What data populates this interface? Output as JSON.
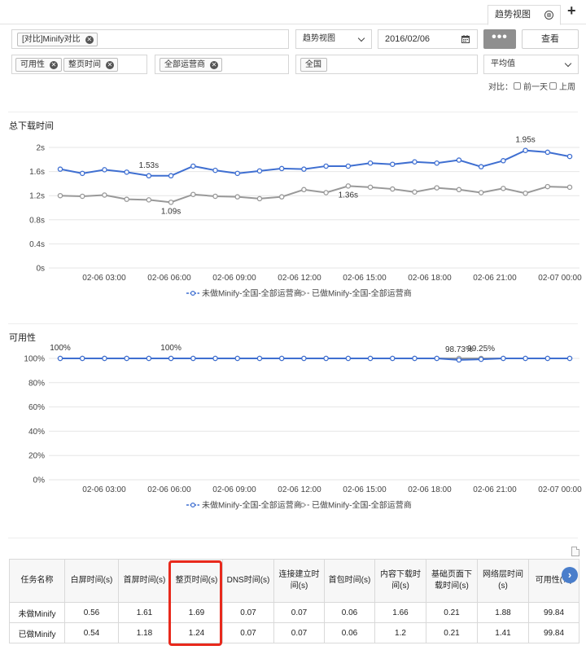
{
  "tabs": {
    "active_label": "趋势视图",
    "close_glyph": "⊗",
    "add_glyph": "+"
  },
  "filters": {
    "task_chip": "[对比]Minify对比",
    "view_select": "趋势视图",
    "date_value": "2016/02/06",
    "more_label": "•••",
    "query_label": "查看",
    "metric_chips": [
      "可用性",
      "整页时间"
    ],
    "isp_chip": "全部运营商",
    "region_chip": "全国",
    "aggregate_select": "平均值",
    "compare_label": "对比：",
    "compare_options": [
      "前一天",
      "上周"
    ]
  },
  "chart_data": [
    {
      "type": "line",
      "title": "总下载时间",
      "x_ticks": [
        "02-06 03:00",
        "02-06 06:00",
        "02-06 09:00",
        "02-06 12:00",
        "02-06 15:00",
        "02-06 18:00",
        "02-06 21:00",
        "02-07 00:00"
      ],
      "y_ticks": [
        "2s",
        "1.6s",
        "1.2s",
        "0.8s",
        "0.4s",
        "0s"
      ],
      "ylim": [
        0,
        2
      ],
      "x_index_range": [
        0,
        23
      ],
      "series": [
        {
          "name": "未做Minify-全国-全部运营商",
          "color": "#3f6fd1",
          "values": [
            1.64,
            1.57,
            1.63,
            1.59,
            1.53,
            1.53,
            1.69,
            1.62,
            1.57,
            1.61,
            1.65,
            1.64,
            1.69,
            1.69,
            1.74,
            1.72,
            1.76,
            1.74,
            1.79,
            1.68,
            1.78,
            1.95,
            1.92,
            1.85
          ]
        },
        {
          "name": "已做Minify-全国-全部运营商",
          "color": "#999999",
          "values": [
            1.2,
            1.19,
            1.21,
            1.14,
            1.13,
            1.09,
            1.22,
            1.19,
            1.18,
            1.15,
            1.18,
            1.3,
            1.25,
            1.36,
            1.34,
            1.31,
            1.26,
            1.33,
            1.3,
            1.25,
            1.32,
            1.24,
            1.35,
            1.34
          ]
        }
      ],
      "annotations": [
        {
          "series": 0,
          "index": 4,
          "label": "1.53s"
        },
        {
          "series": 1,
          "index": 5,
          "label": "1.09s"
        },
        {
          "series": 1,
          "index": 13,
          "label": "1.36s"
        },
        {
          "series": 0,
          "index": 21,
          "label": "1.95s"
        }
      ],
      "legend_position": "bottom-center",
      "grid": true
    },
    {
      "type": "line",
      "title": "可用性",
      "x_ticks": [
        "02-06 03:00",
        "02-06 06:00",
        "02-06 09:00",
        "02-06 12:00",
        "02-06 15:00",
        "02-06 18:00",
        "02-06 21:00",
        "02-07 00:00"
      ],
      "y_ticks": [
        "100%",
        "80%",
        "60%",
        "40%",
        "20%",
        "0%"
      ],
      "ylim": [
        0,
        100
      ],
      "x_index_range": [
        0,
        23
      ],
      "series": [
        {
          "name": "未做Minify-全国-全部运营商",
          "color": "#3f6fd1",
          "values": [
            100,
            100,
            100,
            100,
            100,
            100,
            100,
            100,
            100,
            100,
            100,
            100,
            100,
            100,
            100,
            100,
            100,
            100,
            98.73,
            99.25,
            100,
            100,
            100,
            100
          ]
        },
        {
          "name": "已做Minify-全国-全部运营商",
          "color": "#999999",
          "values": [
            100,
            100,
            100,
            100,
            100,
            100,
            100,
            100,
            100,
            100,
            100,
            100,
            100,
            100,
            100,
            100,
            100,
            100,
            100,
            100,
            100,
            100,
            100,
            100
          ]
        }
      ],
      "annotations": [
        {
          "series": 0,
          "index": 0,
          "label": "100%"
        },
        {
          "series": 0,
          "index": 5,
          "label": "100%"
        },
        {
          "series": 0,
          "index": 18,
          "label": "98.73%"
        },
        {
          "series": 0,
          "index": 19,
          "label": "99.25%"
        }
      ],
      "legend_position": "bottom-center",
      "grid": true
    }
  ],
  "table": {
    "headers": [
      "任务名称",
      "白屏时间(s)",
      "首屏时间(s)",
      "整页时间(s)",
      "DNS时间(s)",
      "连接建立时间(s)",
      "首包时间(s)",
      "内容下载时间(s)",
      "基础页面下载时间(s)",
      "网络层时间(s)",
      "可用性(%)"
    ],
    "rows": [
      [
        "未做Minify",
        "0.56",
        "1.61",
        "1.69",
        "0.07",
        "0.07",
        "0.06",
        "1.66",
        "0.21",
        "1.88",
        "99.84"
      ],
      [
        "已做Minify",
        "0.54",
        "1.18",
        "1.24",
        "0.07",
        "0.07",
        "0.06",
        "1.2",
        "0.21",
        "1.41",
        "99.84"
      ]
    ],
    "highlight_color": "#e8291c",
    "scroll_glyph": "›"
  }
}
